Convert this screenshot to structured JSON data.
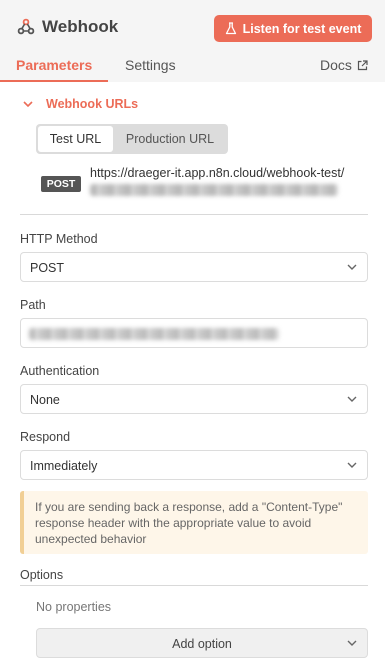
{
  "header": {
    "title": "Webhook",
    "listen_button": "Listen for test event",
    "icon": "webhook-icon"
  },
  "tabs": [
    {
      "label": "Parameters",
      "active": true
    },
    {
      "label": "Settings",
      "active": false
    }
  ],
  "docs": {
    "label": "Docs",
    "icon": "external-link-icon"
  },
  "webhook_urls": {
    "section_label": "Webhook URLs",
    "segments": [
      {
        "label": "Test URL",
        "selected": true
      },
      {
        "label": "Production URL",
        "selected": false
      }
    ],
    "method_badge": "POST",
    "url": "https://draeger-it.app.n8n.cloud/webhook-test/"
  },
  "fields": {
    "http_method": {
      "label": "HTTP Method",
      "value": "POST"
    },
    "path": {
      "label": "Path"
    },
    "authentication": {
      "label": "Authentication",
      "value": "None"
    },
    "respond": {
      "label": "Respond",
      "value": "Immediately"
    }
  },
  "notice": "If you are sending back a response, add a \"Content-Type\" response header with the appropriate value to avoid unexpected behavior",
  "options": {
    "label": "Options",
    "empty_text": "No properties",
    "add_button": "Add option"
  },
  "colors": {
    "accent": "#ec6c57",
    "notice_bg": "#fef6e9",
    "notice_border": "#f1cf95",
    "badge_bg": "#555555"
  }
}
